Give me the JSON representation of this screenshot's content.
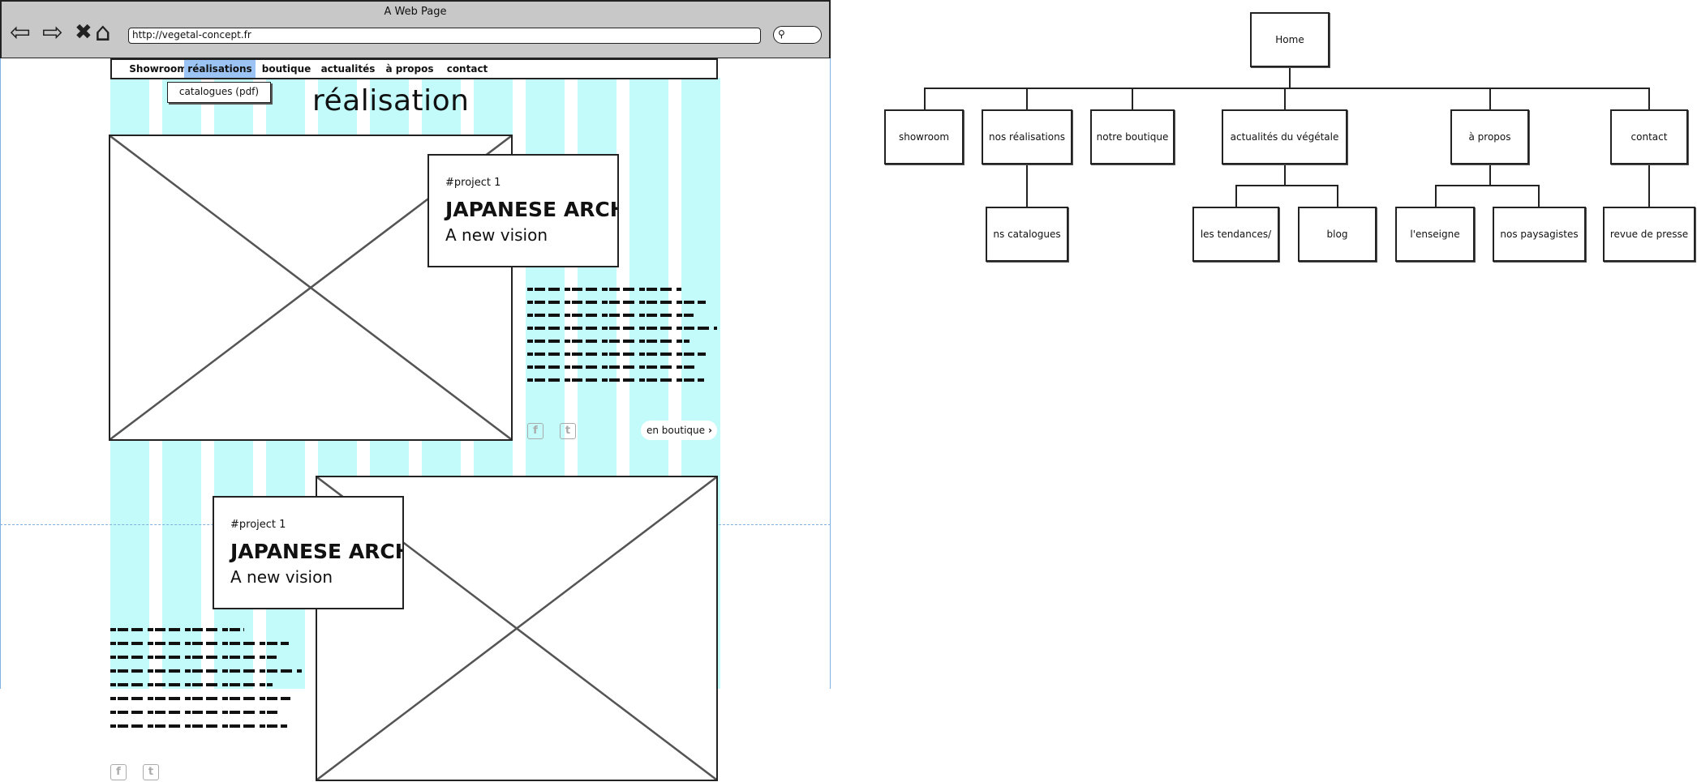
{
  "browser": {
    "window_title": "A Web Page",
    "url": "http://vegetal-concept.fr",
    "icons": [
      "back-arrow-icon",
      "forward-arrow-icon",
      "stop-icon",
      "home-icon",
      "search-icon"
    ]
  },
  "menu": {
    "items": [
      "Showroom",
      "réalisations",
      "boutique",
      "actualités",
      "à propos",
      "contact"
    ],
    "active": "réalisations",
    "dropdown_item": "catalogues (pdf)"
  },
  "page": {
    "heading": "réalisation",
    "projects": [
      {
        "tag": "#project 1",
        "title": "JAPANESE ARCHITECTURE",
        "subtitle": "A new vision"
      },
      {
        "tag": "#project 1",
        "title": "JAPANESE ARCHITECTURE",
        "subtitle": "A new vision"
      }
    ],
    "boutique_button": "en boutique",
    "social_icons": [
      "facebook-icon",
      "twitter-icon"
    ]
  },
  "sitemap": {
    "root": "Home",
    "sections": [
      {
        "label": "showroom",
        "children": []
      },
      {
        "label": "nos réalisations",
        "children": [
          "ns catalogues"
        ]
      },
      {
        "label": "notre boutique",
        "children": []
      },
      {
        "label": "actualités du végétale",
        "children": [
          "les tendances/",
          "blog"
        ]
      },
      {
        "label": "à propos",
        "children": [
          "l'enseigne",
          "nos paysagistes"
        ]
      },
      {
        "label": "contact",
        "children": [
          "revue de presse"
        ]
      }
    ]
  },
  "colors": {
    "grid_column": "#c3fbfb",
    "menu_active": "#9bc4f4",
    "chrome": "#c8c8c8",
    "guide": "#7fb2e0"
  }
}
